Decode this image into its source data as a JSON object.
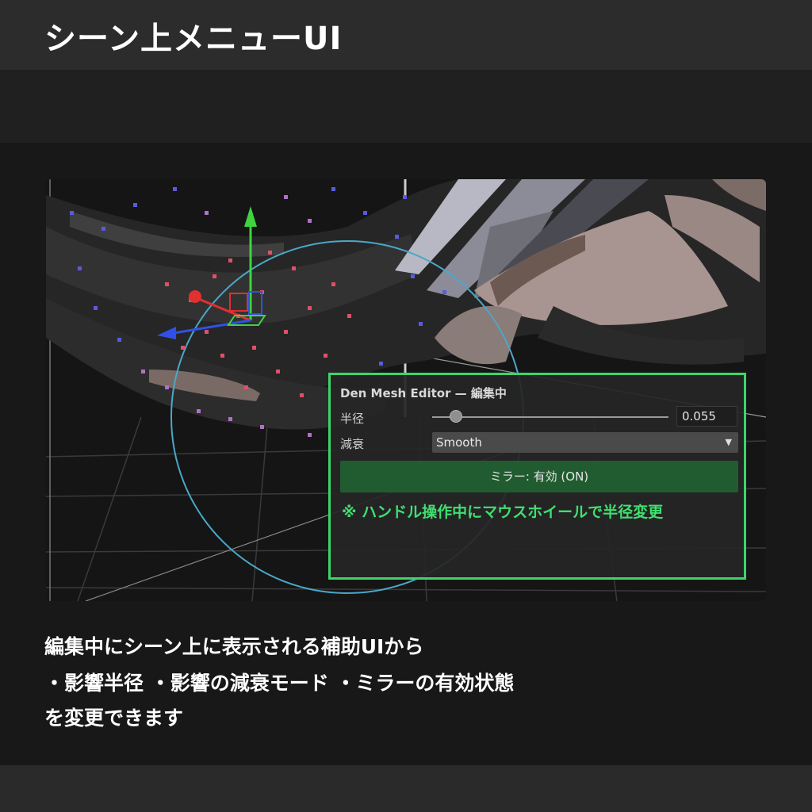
{
  "title": "シーン上メニューUI",
  "panel": {
    "title": "Den Mesh Editor — 編集中",
    "radius_label": "半径",
    "radius_value": "0.055",
    "radius_fraction": 0.1,
    "falloff_label": "減衰",
    "falloff_value": "Smooth",
    "mirror_button": "ミラー: 有効 (ON)",
    "hint": "※ ハンドル操作中にマウスホイールで半径変更"
  },
  "caption": {
    "line1": "編集中にシーン上に表示される補助UIから",
    "line2": "・影響半径 ・影響の減衰モード ・ミラーの有効状態",
    "line3": "を変更できます"
  },
  "colors": {
    "accent": "#3fd46b",
    "mirror_on": "#215c30",
    "brush_circle": "#4aa8c8",
    "vertex_red": "#e0506a",
    "vertex_blue": "#5a5ae0"
  },
  "icons": {
    "gizmo": "move-gizmo-icon",
    "dropdown": "triangle-down-icon"
  }
}
